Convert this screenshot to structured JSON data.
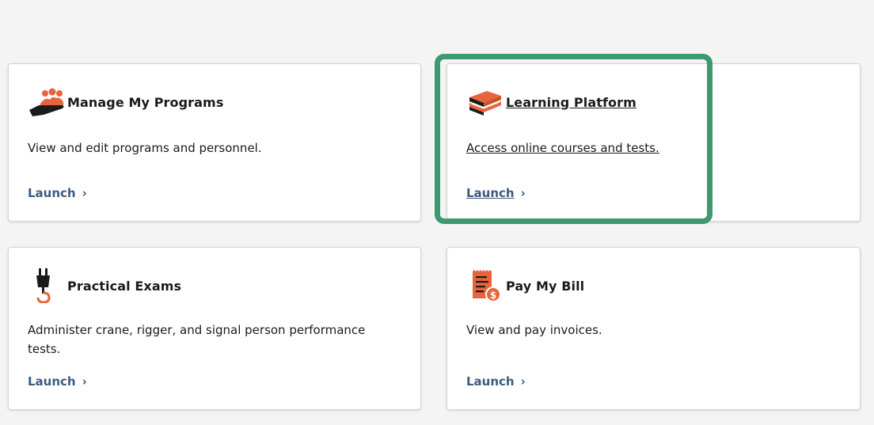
{
  "colors": {
    "accent_orange": "#e8643c",
    "launch_blue": "#3d5a80",
    "focus_green": "#3d9970"
  },
  "cards": [
    {
      "title": "Manage My Programs",
      "description": "View and edit programs and personnel.",
      "launch_label": "Launch",
      "icon": "hand-people-icon"
    },
    {
      "title": "Learning Platform",
      "description": "Access online courses and tests.",
      "launch_label": "Launch",
      "icon": "books-icon"
    },
    {
      "title": "Practical Exams",
      "description": "Administer crane, rigger, and signal person performance tests.",
      "launch_label": "Launch",
      "icon": "crane-hook-icon"
    },
    {
      "title": "Pay My Bill",
      "description": "View and pay invoices.",
      "launch_label": "Launch",
      "icon": "invoice-dollar-icon"
    }
  ]
}
